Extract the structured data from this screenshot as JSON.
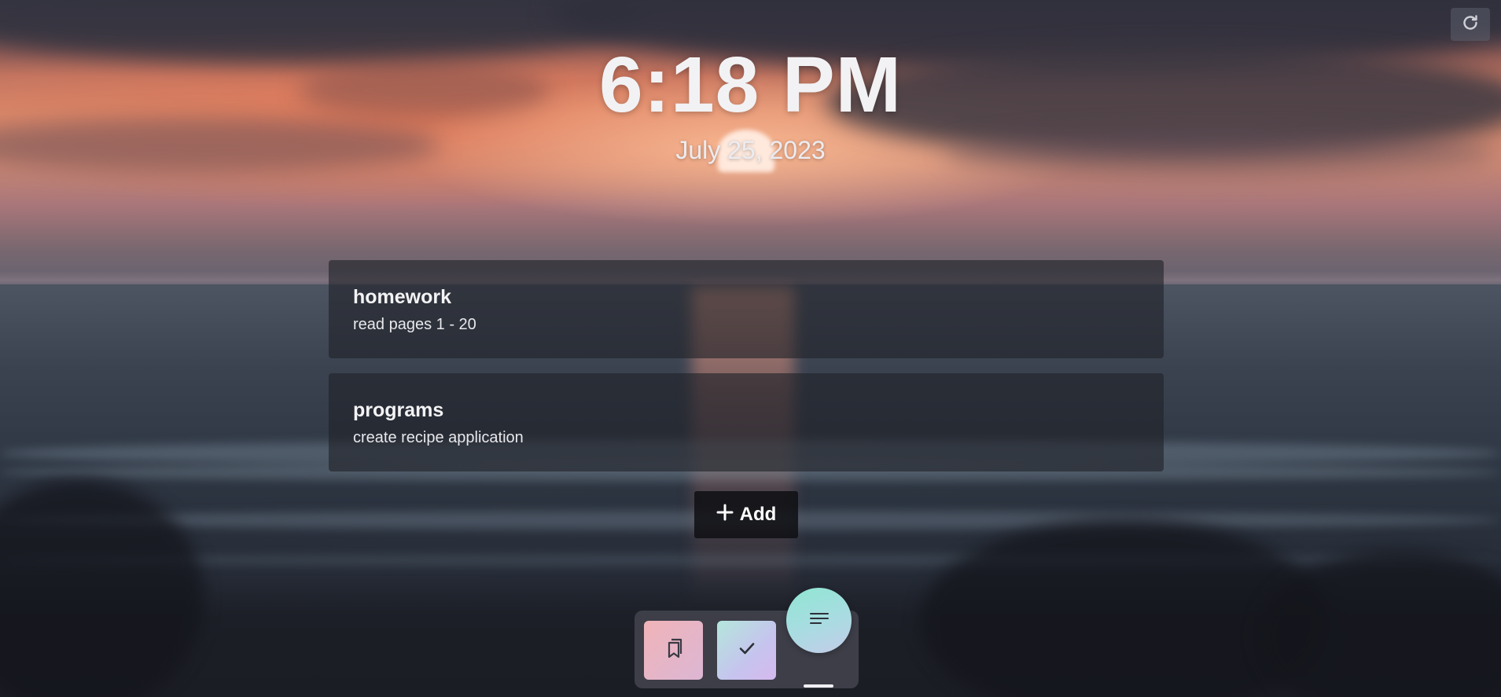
{
  "clock": {
    "time": "6:18 PM",
    "date": "July 25, 2023"
  },
  "notes": [
    {
      "title": "homework",
      "body": "read pages 1 - 20"
    },
    {
      "title": "programs",
      "body": "create recipe application"
    }
  ],
  "add_button": {
    "label": "Add",
    "icon": "plus-icon"
  },
  "toolbar": {
    "refresh_icon": "refresh-icon"
  },
  "dock": {
    "items": [
      {
        "icon": "bookmarks-icon"
      },
      {
        "icon": "checkmark-icon"
      },
      {
        "icon": "notes-list-icon",
        "active": true
      }
    ]
  },
  "colors": {
    "note_bg": "#212228",
    "bookmarks_tile": "#f0b4b8",
    "todo_tile": "#b4e6dc",
    "fab": "#8fe6d2"
  }
}
